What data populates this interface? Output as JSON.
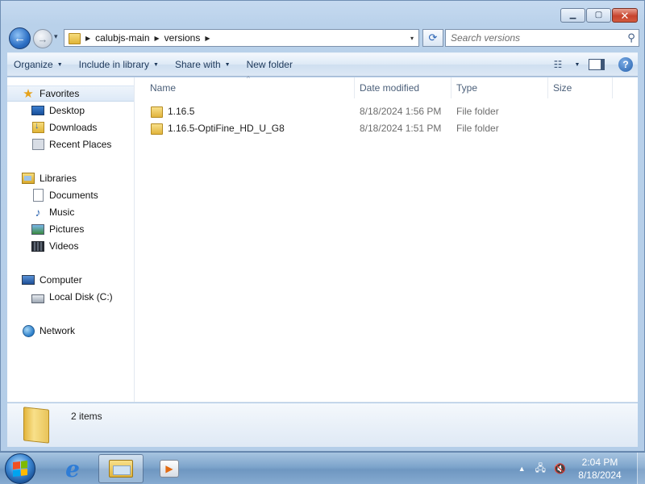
{
  "window": {
    "minimize_glyph": "▁",
    "maximize_glyph": "▢",
    "close_glyph": "✕"
  },
  "nav": {
    "back_glyph": "←",
    "forward_glyph": "→",
    "history_glyph": "▾",
    "breadcrumbs": [
      "calubjs-main",
      "versions"
    ],
    "crumb_sep_glyph": "▶",
    "address_drop_glyph": "▾",
    "refresh_glyph": "⟳",
    "search_placeholder": "Search versions",
    "search_glyph": "⚲"
  },
  "toolbar": {
    "organize": "Organize",
    "include_in_library": "Include in library",
    "share_with": "Share with",
    "new_folder": "New folder",
    "dropdown_glyph": "▼",
    "views_glyph": "☷",
    "help_glyph": "?"
  },
  "navpane": {
    "favorites": "Favorites",
    "desktop": "Desktop",
    "downloads": "Downloads",
    "recent_places": "Recent Places",
    "libraries": "Libraries",
    "documents": "Documents",
    "music": "Music",
    "pictures": "Pictures",
    "videos": "Videos",
    "computer": "Computer",
    "local_disk": "Local Disk (C:)",
    "network": "Network",
    "star_glyph": "★",
    "music_glyph": "♪"
  },
  "columns": {
    "name": "Name",
    "date_modified": "Date modified",
    "type": "Type",
    "size": "Size",
    "sort_glyph": "^"
  },
  "files": [
    {
      "name": "1.16.5",
      "date": "8/18/2024 1:56 PM",
      "type": "File folder"
    },
    {
      "name": "1.16.5-OptiFine_HD_U_G8",
      "date": "8/18/2024 1:51 PM",
      "type": "File folder"
    }
  ],
  "details": {
    "item_count": "2 items"
  },
  "taskbar": {
    "ie_glyph": "e",
    "media_glyph": "▶",
    "tray_arrow_glyph": "▲",
    "network_glyph": "🖧",
    "volume_glyph": "🔇",
    "time": "2:04 PM",
    "date": "8/18/2024"
  },
  "colors": {
    "start_flag": [
      "#f25022",
      "#7fba00",
      "#00a4ef",
      "#ffb900"
    ]
  }
}
